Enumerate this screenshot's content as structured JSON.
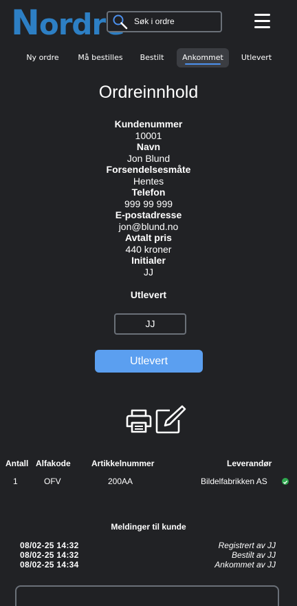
{
  "header": {
    "logo_first": "N",
    "logo_rest": "ordre",
    "search_placeholder": "Søk i ordre"
  },
  "tabs": [
    {
      "label": "Ny ordre"
    },
    {
      "label": "Må bestilles"
    },
    {
      "label": "Bestilt"
    },
    {
      "label": "Ankommet",
      "active": true
    },
    {
      "label": "Utlevert"
    }
  ],
  "title": "Ordreinnhold",
  "info": {
    "kundenummer_label": "Kundenummer",
    "kundenummer": "10001",
    "navn_label": "Navn",
    "navn": "Jon Blund",
    "forsendelse_label": "Forsendelsesmåte",
    "forsendelse": "Hentes",
    "telefon_label": "Telefon",
    "telefon": "999 99 999",
    "epost_label": "E-postadresse",
    "epost": "jon@blund.no",
    "pris_label": "Avtalt pris",
    "pris": "440 kroner",
    "initialer_label": "Initialer",
    "initialer": "JJ"
  },
  "utlevert": {
    "heading": "Utlevert",
    "input_value": "JJ",
    "button_label": "Utlevert"
  },
  "table": {
    "headers": [
      "Antall",
      "Alfakode",
      "Artikkelnummer",
      "Leverandør"
    ],
    "rows": [
      {
        "antall": "1",
        "alfakode": "OFV",
        "artikkelnummer": "200AA",
        "leverandor": "Bildelfabrikken AS",
        "status_color": "#2fa84f"
      }
    ]
  },
  "messages": {
    "heading": "Meldinger til kunde",
    "items": [
      {
        "time": "08/02-25 14:32",
        "text": "Registrert av JJ"
      },
      {
        "time": "08/02-25 14:32",
        "text": "Bestilt av JJ"
      },
      {
        "time": "08/02-25 14:34",
        "text": "Ankommet av JJ"
      }
    ]
  },
  "colors": {
    "background": "#212225",
    "brand": "#2d7fc4",
    "accent_button": "#5b9ff0",
    "tab_underline": "#4c91f0"
  },
  "icons": [
    "search-icon",
    "hamburger-menu-icon",
    "printer-icon",
    "edit-note-icon",
    "status-check-icon"
  ]
}
